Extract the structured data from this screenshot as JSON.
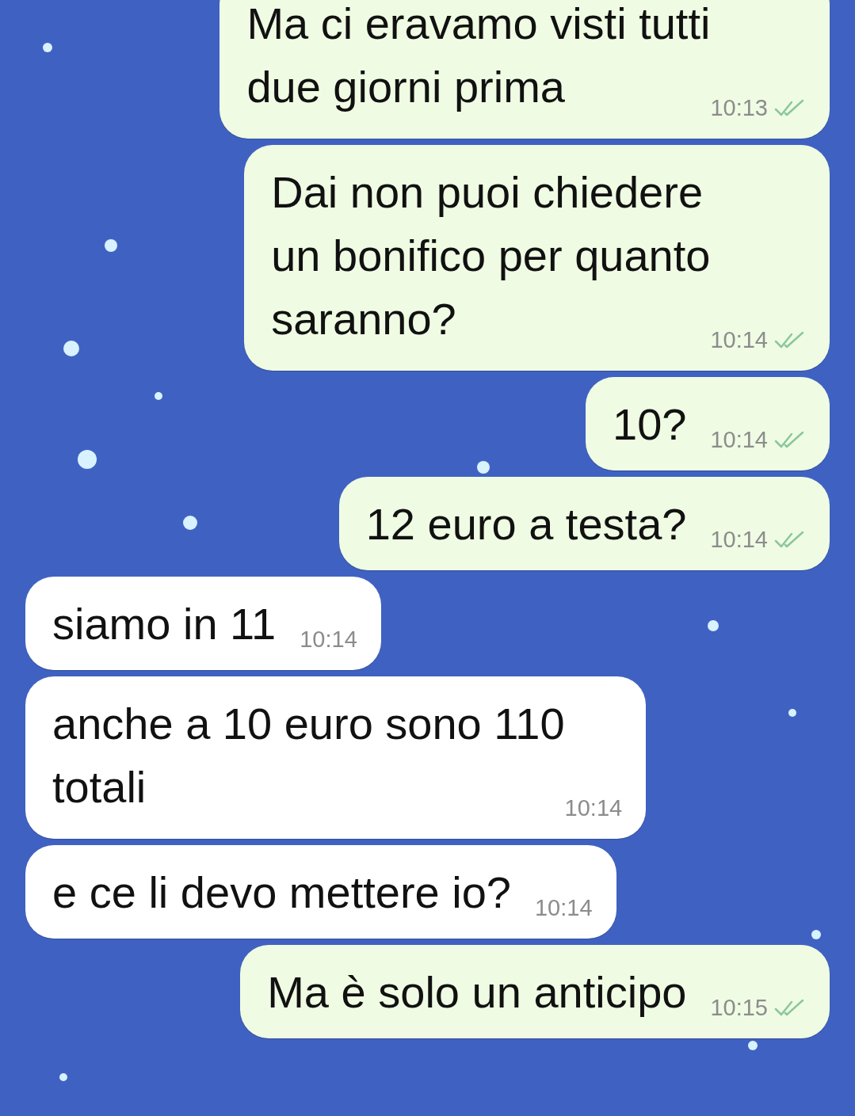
{
  "messages": [
    {
      "kind": "outgoing",
      "text": "Ma ci eravamo visti tutti\ndue giorni prima",
      "time": "10:13",
      "read": false
    },
    {
      "kind": "outgoing",
      "text": "Dai non puoi chiedere\nun bonifico per quanto\nsaranno?",
      "time": "10:14",
      "read": false
    },
    {
      "kind": "outgoing",
      "text": "10?",
      "time": "10:14",
      "read": false
    },
    {
      "kind": "outgoing",
      "text": "12 euro a testa?",
      "time": "10:14",
      "read": false
    },
    {
      "kind": "incoming",
      "text": "siamo in 11",
      "time": "10:14"
    },
    {
      "kind": "incoming",
      "text": "anche a 10 euro sono 110\ntotali",
      "time": "10:14"
    },
    {
      "kind": "incoming",
      "text": "e ce li devo mettere io?",
      "time": "10:14"
    },
    {
      "kind": "outgoing",
      "text": "Ma è solo un anticipo",
      "time": "10:15",
      "read": false
    }
  ]
}
